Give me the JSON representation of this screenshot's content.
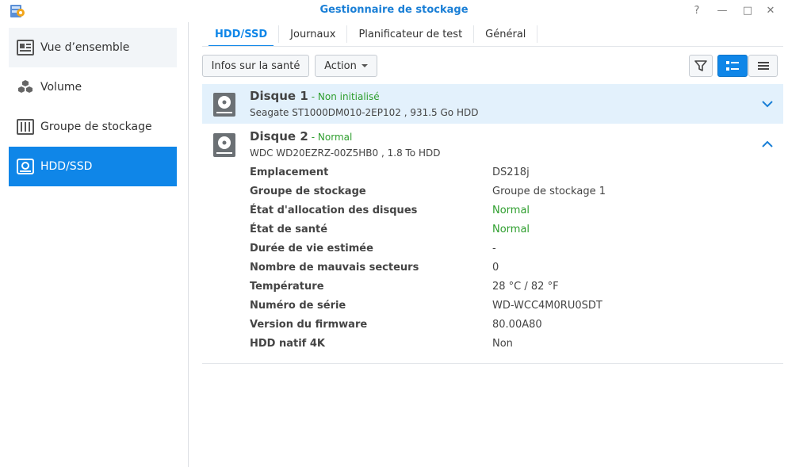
{
  "window": {
    "title": "Gestionnaire de stockage",
    "help": "?",
    "minimize": "—",
    "maximize": "□",
    "close": "✕"
  },
  "sidebar": {
    "items": [
      {
        "label": "Vue d’ensemble",
        "icon": "overview-icon"
      },
      {
        "label": "Volume",
        "icon": "volume-cubes-icon"
      },
      {
        "label": "Groupe de stockage",
        "icon": "storage-pool-icon"
      },
      {
        "label": "HDD/SSD",
        "icon": "hdd-icon",
        "active": true
      }
    ]
  },
  "tabs": [
    {
      "label": "HDD/SSD",
      "active": true
    },
    {
      "label": "Journaux"
    },
    {
      "label": "Planificateur de test"
    },
    {
      "label": "Général"
    }
  ],
  "toolbar": {
    "health_label": "Infos sur la santé",
    "action_label": "Action"
  },
  "disks": [
    {
      "name": "Disque 1",
      "status": "- Non initialisé",
      "model": "Seagate ST1000DM010-2EP102 , 931.5 Go HDD",
      "expanded": false
    },
    {
      "name": "Disque 2",
      "status": "- Normal",
      "model": "WDC WD20EZRZ-00Z5HB0 , 1.8 To HDD",
      "expanded": true,
      "properties": [
        {
          "key": "Emplacement",
          "value": "DS218j"
        },
        {
          "key": "Groupe de stockage",
          "value": "Groupe de stockage 1"
        },
        {
          "key": "État d'allocation des disques",
          "value": "Normal",
          "ok": true
        },
        {
          "key": "État de santé",
          "value": "Normal",
          "ok": true
        },
        {
          "key": "Durée de vie estimée",
          "value": "-"
        },
        {
          "key": "Nombre de mauvais secteurs",
          "value": "0"
        },
        {
          "key": "Température",
          "value": "28 °C / 82 °F"
        },
        {
          "key": "Numéro de série",
          "value": "WD-WCC4M0RU0SDT"
        },
        {
          "key": "Version du firmware",
          "value": "80.00A80"
        },
        {
          "key": "HDD natif 4K",
          "value": "Non"
        }
      ]
    }
  ],
  "colors": {
    "accent": "#0f86e8",
    "ok": "#2e9e2e",
    "selected_row": "#e3f1fc"
  }
}
